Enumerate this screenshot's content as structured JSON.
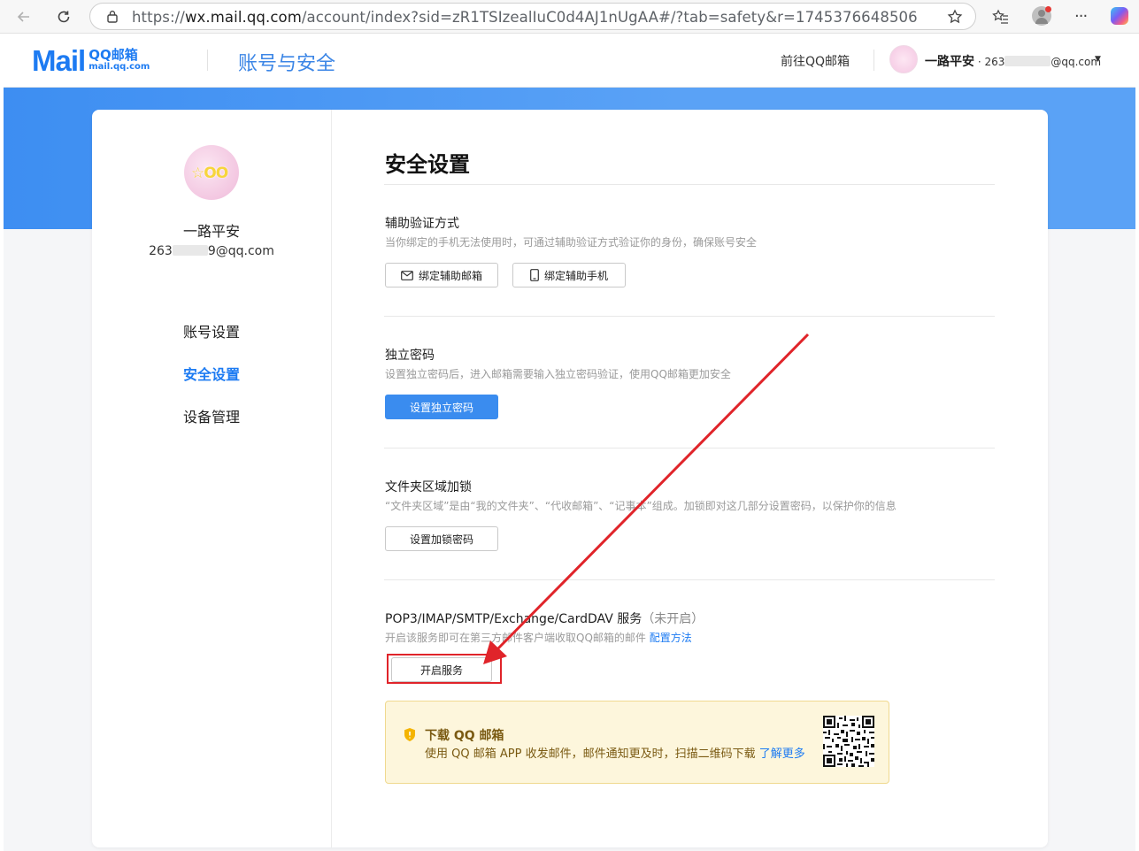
{
  "browser": {
    "url_prefix": "https://",
    "url_host": "wx.mail.qq.com",
    "url_rest": "/account/index?sid=zR1TSIzealIuC0d4AJ1nUgAA#/?tab=safety&r=1745376648506"
  },
  "header": {
    "logo_mail": "Mail",
    "logo_qq": "QQ邮箱",
    "logo_domain": "mail.qq.com",
    "title": "账号与安全",
    "goto_link": "前往QQ邮箱",
    "user_name": "一路平安",
    "user_sep": " · 263",
    "user_email_tail": "@qq.com"
  },
  "sidebar": {
    "name": "一路平安",
    "email_head": "263",
    "email_tail": "9@qq.com",
    "items": [
      {
        "label": "账号设置"
      },
      {
        "label": "安全设置"
      },
      {
        "label": "设备管理"
      }
    ]
  },
  "main": {
    "title": "安全设置",
    "sections": [
      {
        "title": "辅助验证方式",
        "desc": "当你绑定的手机无法使用时，可通过辅助验证方式验证你的身份，确保账号安全",
        "buttons": [
          "绑定辅助邮箱",
          "绑定辅助手机"
        ]
      },
      {
        "title": "独立密码",
        "desc": "设置独立密码后，进入邮箱需要输入独立密码验证，使用QQ邮箱更加安全",
        "buttons": [
          "设置独立密码"
        ]
      },
      {
        "title": "文件夹区域加锁",
        "desc": "“文件夹区域”是由“我的文件夹”、“代收邮箱”、“记事本”组成。加锁即对这几部分设置密码，以保护你的信息",
        "buttons": [
          "设置加锁密码"
        ]
      },
      {
        "title": "POP3/IMAP/SMTP/Exchange/CardDAV 服务",
        "status": "（未开启）",
        "desc": "开启该服务即可在第三方邮件客户端收取QQ邮箱的邮件",
        "link": "配置方法",
        "buttons": [
          "开启服务"
        ]
      }
    ],
    "download": {
      "title": "下载 QQ 邮箱",
      "text": "使用 QQ 邮箱 APP 收发邮件，邮件通知更及时，扫描二维码下载",
      "link": "了解更多"
    }
  },
  "colors": {
    "accent": "#1d7bf2",
    "band": "#4a96f3",
    "annotation": "#e0242a"
  }
}
